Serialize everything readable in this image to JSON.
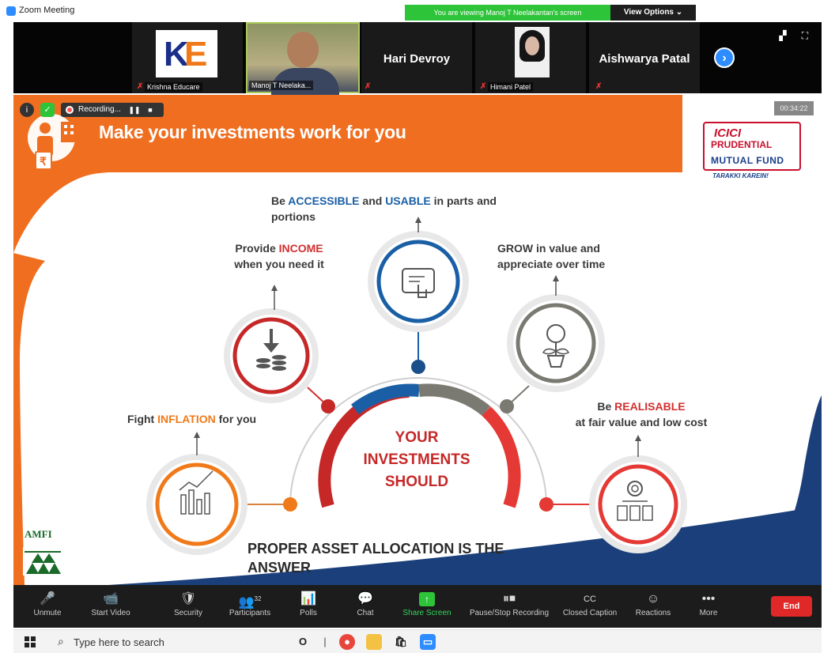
{
  "window": {
    "title": "Zoom Meeting"
  },
  "banner": {
    "viewing": "You are viewing Manoj T Neelakantan's screen",
    "view_options": "View Options ⌄"
  },
  "participants": [
    {
      "name": "Krishna Educare"
    },
    {
      "name": "Manoj T Neelaka..."
    },
    {
      "name": "Hari Devroy"
    },
    {
      "name": "Himani Patel"
    },
    {
      "name": "Aishwarya Patal"
    }
  ],
  "logo_text": {
    "ke": "K",
    "ke2": "E"
  },
  "recording": {
    "label": "Recording..."
  },
  "timer": "00:34:22",
  "slide": {
    "title": "Make your investments work for you",
    "brand": {
      "line1": "ICICI",
      "line2": "PRUDENTIAL",
      "line3": "MUTUAL FUND",
      "tagline": "TARAKKI KAREIN!"
    },
    "points": {
      "inflation": {
        "pre": "Fight ",
        "hl": "INFLATION",
        "post": " for you"
      },
      "income": {
        "pre": "Provide ",
        "hl": "INCOME",
        "line2": "when you need it"
      },
      "accessible": {
        "pre": "Be ",
        "hl1": "ACCESSIBLE",
        "mid": " and ",
        "hl2": "USABLE",
        "post": " in parts and",
        "line2": "portions"
      },
      "grow": {
        "hl": "GROW",
        "post": " in value and",
        "line2": "appreciate over time"
      },
      "realisable": {
        "pre": "Be ",
        "hl": "REALISABLE",
        "line2": "at fair value and low cost"
      }
    },
    "center": {
      "l1": "YOUR",
      "l2": "INVESTMENTS",
      "l3": "SHOULD"
    },
    "answer": {
      "l1": "PROPER ASSET ALLOCATION IS THE",
      "l2": "ANSWER"
    },
    "amfi": "AMFI",
    "rupee": "₹"
  },
  "toolbar": [
    {
      "label": "Unmute",
      "icon": "🎤"
    },
    {
      "label": "Start Video",
      "icon": "📹"
    },
    {
      "label": "Security",
      "icon": "🛡"
    },
    {
      "label": "Participants",
      "icon": "👥",
      "count": "32"
    },
    {
      "label": "Polls",
      "icon": "📊"
    },
    {
      "label": "Chat",
      "icon": "💬"
    },
    {
      "label": "Share Screen",
      "icon": "↑"
    },
    {
      "label": "Pause/Stop Recording",
      "icon": "⏸⏹"
    },
    {
      "label": "Closed Caption",
      "icon": "CC"
    },
    {
      "label": "Reactions",
      "icon": "☺"
    },
    {
      "label": "More",
      "icon": "•••"
    }
  ],
  "end_label": "End",
  "taskbar": {
    "search_placeholder": "Type here to search"
  },
  "colors": {
    "orange": "#f07a1a",
    "red": "#d32f2f",
    "blue": "#1a5fa5",
    "gray": "#7a7a72",
    "zoom_blue": "#2d8cff",
    "green": "#2ec43a"
  }
}
